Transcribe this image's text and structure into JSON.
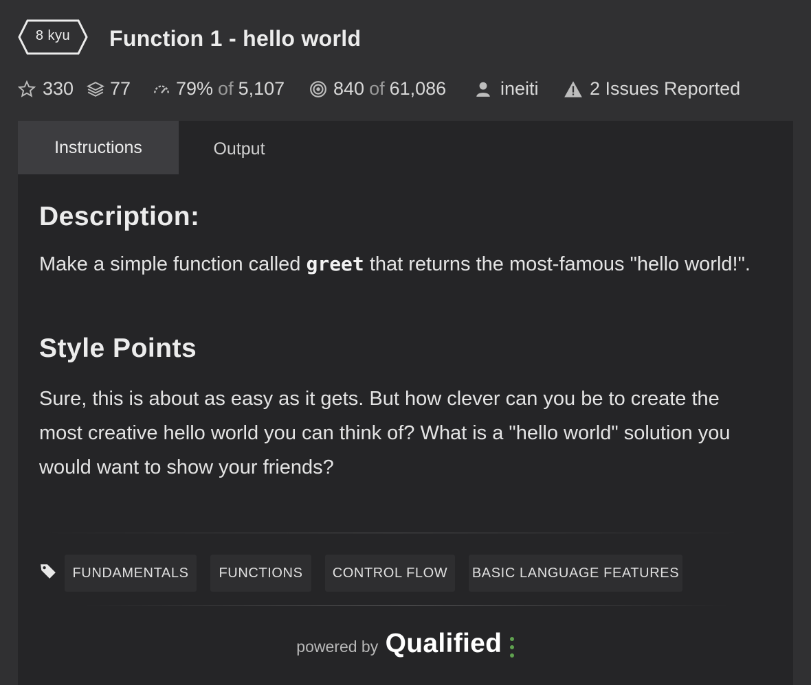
{
  "header": {
    "rank": "8 kyu",
    "title": "Function 1 - hello world"
  },
  "stats": {
    "stars": "330",
    "collections": "77",
    "satisfaction_pct": "79%",
    "satisfaction_of": "of",
    "satisfaction_total": "5,107",
    "completed": "840",
    "completed_of": "of",
    "completed_total": "61,086",
    "author": "ineiti",
    "issues": "2 Issues Reported"
  },
  "tabs": [
    {
      "label": "Instructions",
      "active": true
    },
    {
      "label": "Output",
      "active": false
    }
  ],
  "description": {
    "heading": "Description:",
    "text_before": "Make a simple function called ",
    "keyword": "greet",
    "text_after": " that returns the most-famous \"hello world!\"."
  },
  "style_points": {
    "heading": "Style Points",
    "text": "Sure, this is about as easy as it gets. But how clever can you be to create the most creative hello world you can think of? What is a \"hello world\" solution you would want to show your friends?"
  },
  "tags": [
    "FUNDAMENTALS",
    "FUNCTIONS",
    "CONTROL FLOW",
    "BASIC LANGUAGE FEATURES"
  ],
  "footer": {
    "powered_by": "powered by",
    "brand": "Qualified"
  },
  "colors": {
    "background": "#303032",
    "panel": "#252527",
    "active_tab": "#3d3d40",
    "tag_bg": "#2e2e30",
    "brand_dots": "#5fa14f"
  },
  "icons": [
    "star-icon",
    "layers-icon",
    "gauge-icon",
    "target-icon",
    "user-icon",
    "warning-icon",
    "tag-icon"
  ]
}
